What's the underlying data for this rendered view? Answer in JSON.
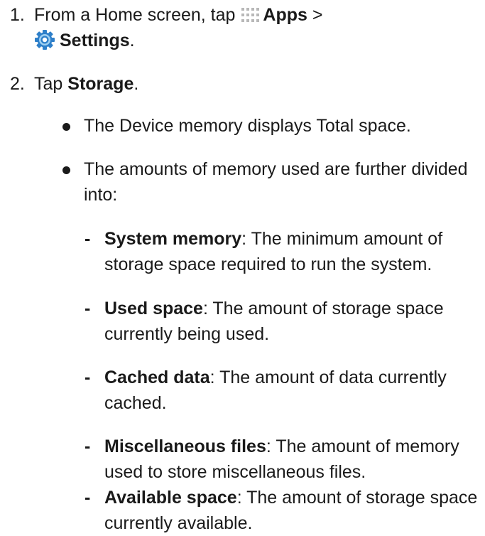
{
  "steps": [
    {
      "number": "1.",
      "prefix": "From a Home screen, tap",
      "apps_label": "Apps",
      "separator": ">",
      "settings_label": "Settings",
      "suffix": ".",
      "icons": [
        "apps-grid-icon",
        "settings-gear-icon"
      ]
    },
    {
      "number": "2.",
      "prefix": "Tap",
      "bold": "Storage",
      "suffix": "."
    }
  ],
  "bullets": [
    "The Device memory displays Total space.",
    "The amounts of memory used are further divided into:"
  ],
  "subitems": [
    {
      "term": "System memory",
      "desc": ": The minimum amount of storage space required to run the system."
    },
    {
      "term": "Used space",
      "desc": ": The amount of storage space currently being used."
    },
    {
      "term": "Cached data",
      "desc": ": The amount of data currently cached."
    },
    {
      "term": "Miscellaneous files",
      "desc": ": The amount of memory used to store miscellaneous files."
    },
    {
      "term": "Available space",
      "desc": ": The amount of storage space currently available."
    }
  ],
  "dash": "-",
  "colors": {
    "text": "#1a1a1a",
    "apps_icon": "#b8b8b8",
    "settings_icon_outer": "#2e7fc9",
    "settings_icon_inner": "#9fd0f2"
  }
}
